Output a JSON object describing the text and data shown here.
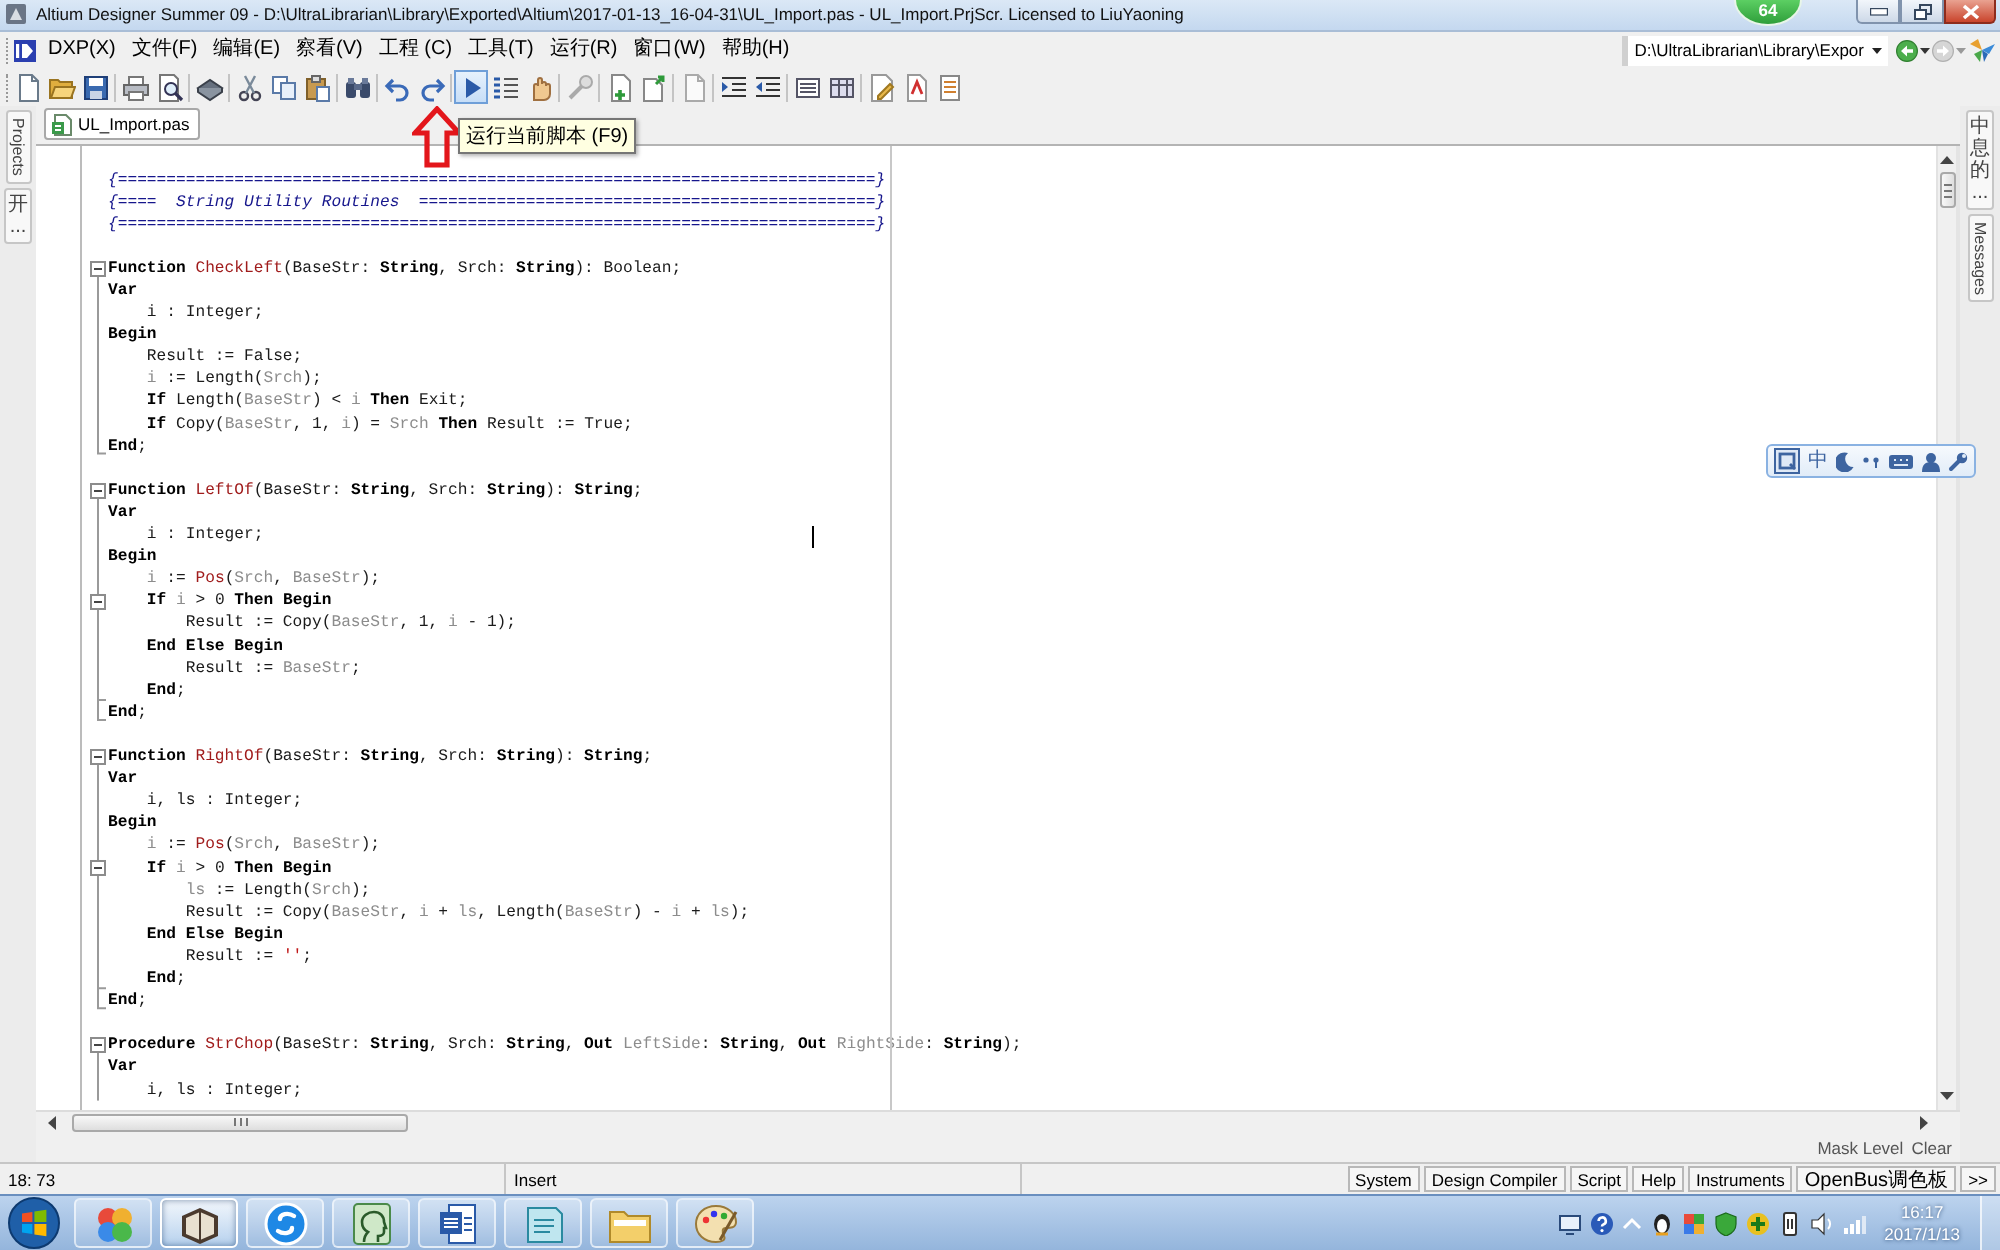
{
  "title_bar": {
    "title": "Altium Designer Summer 09 - D:\\UltraLibrarian\\Library\\Exported\\Altium\\2017-01-13_16-04-31\\UL_Import.pas - UL_Import.PrjScr. Licensed to LiuYaoning"
  },
  "floating_badge": {
    "text": "64"
  },
  "menu_bar": {
    "items": [
      "DXP(X)",
      "文件(F)",
      "编辑(E)",
      "察看(V)",
      "工程 (C)",
      "工具(T)",
      "运行(R)",
      "窗口(W)",
      "帮助(H)"
    ],
    "path": "D:\\UltraLibrarian\\Library\\Expor"
  },
  "toolbar": {
    "buttons": [
      {
        "kind": "new",
        "highlighted": false
      },
      {
        "kind": "open",
        "highlighted": false
      },
      {
        "kind": "save",
        "highlighted": false
      },
      {
        "kind": "separator"
      },
      {
        "kind": "print",
        "highlighted": false
      },
      {
        "kind": "preview",
        "highlighted": false
      },
      {
        "kind": "separator"
      },
      {
        "kind": "chip",
        "highlighted": false
      },
      {
        "kind": "separator"
      },
      {
        "kind": "cut",
        "highlighted": false
      },
      {
        "kind": "copy",
        "highlighted": false
      },
      {
        "kind": "paste",
        "highlighted": false
      },
      {
        "kind": "separator"
      },
      {
        "kind": "find",
        "highlighted": false
      },
      {
        "kind": "separator"
      },
      {
        "kind": "undo",
        "highlighted": false
      },
      {
        "kind": "redo",
        "highlighted": false
      },
      {
        "kind": "separator"
      },
      {
        "kind": "run",
        "highlighted": true
      },
      {
        "kind": "step",
        "highlighted": false
      },
      {
        "kind": "stop",
        "highlighted": false
      },
      {
        "kind": "separator"
      },
      {
        "kind": "wand",
        "highlighted": false
      },
      {
        "kind": "separator"
      },
      {
        "kind": "page_plus",
        "highlighted": false
      },
      {
        "kind": "page_arrow",
        "highlighted": false
      },
      {
        "kind": "separator"
      },
      {
        "kind": "page",
        "highlighted": false
      },
      {
        "kind": "separator"
      },
      {
        "kind": "indent",
        "highlighted": false
      },
      {
        "kind": "outdent",
        "highlighted": false
      },
      {
        "kind": "separator"
      },
      {
        "kind": "text_panel",
        "highlighted": false
      },
      {
        "kind": "table",
        "highlighted": false
      },
      {
        "kind": "separator"
      },
      {
        "kind": "pencil",
        "highlighted": false
      },
      {
        "kind": "pdf",
        "highlighted": false
      },
      {
        "kind": "list",
        "highlighted": false
      }
    ],
    "tooltip": "运行当前脚本 (F9)"
  },
  "left_panel_tabs": [
    "Projects",
    "开..."
  ],
  "right_panel_tabs": [
    "中息的...",
    "Messages"
  ],
  "document_tabs": [
    {
      "label": "UL_Import.pas",
      "selected": true
    }
  ],
  "editor": {
    "blocks": [
      {
        "lines": [
          {
            "tokens": [
              {
                "kind": "comment",
                "text": "{==============================================================================}"
              }
            ]
          },
          {
            "tokens": [
              {
                "kind": "comment",
                "text": "{====  String Utility Routines  ===============================================}"
              }
            ]
          },
          {
            "tokens": [
              {
                "kind": "comment",
                "text": "{==============================================================================}"
              }
            ]
          }
        ]
      },
      {
        "lines": [
          {
            "expanded": true,
            "tokens": [
              {
                "kind": "keyword",
                "text": "Function"
              },
              {
                "kind": "routine",
                "text": " CheckLeft"
              },
              {
                "kind": "plain",
                "text": "(BaseStr: "
              },
              {
                "kind": "keyword",
                "text": "String"
              },
              {
                "kind": "plain",
                "text": ", Srch: "
              },
              {
                "kind": "keyword",
                "text": "String"
              },
              {
                "kind": "plain",
                "text": "): Boolean;"
              }
            ]
          },
          {
            "tokens": [
              {
                "kind": "keyword",
                "text": "Var"
              }
            ]
          },
          {
            "tokens": [
              {
                "kind": "plain",
                "text": "    i : Integer;"
              }
            ]
          },
          {
            "tokens": [
              {
                "kind": "keyword",
                "text": "Begin"
              }
            ]
          },
          {
            "tokens": [
              {
                "kind": "plain",
                "text": "    Result := False;"
              }
            ]
          },
          {
            "tokens": [
              {
                "kind": "variable",
                "text": "    i"
              },
              {
                "kind": "plain",
                "text": " := Length("
              },
              {
                "kind": "variable",
                "text": "Srch"
              },
              {
                "kind": "plain",
                "text": ");"
              }
            ]
          },
          {
            "tokens": [
              {
                "kind": "keyword",
                "text": "    If"
              },
              {
                "kind": "plain",
                "text": " Length("
              },
              {
                "kind": "variable",
                "text": "BaseStr"
              },
              {
                "kind": "plain",
                "text": ") < "
              },
              {
                "kind": "variable",
                "text": "i"
              },
              {
                "kind": "keyword",
                "text": " Then"
              },
              {
                "kind": "plain",
                "text": " Exit;"
              }
            ]
          },
          {
            "tokens": [
              {
                "kind": "keyword",
                "text": "    If"
              },
              {
                "kind": "plain",
                "text": " Copy("
              },
              {
                "kind": "variable",
                "text": "BaseStr"
              },
              {
                "kind": "plain",
                "text": ", 1, "
              },
              {
                "kind": "variable",
                "text": "i"
              },
              {
                "kind": "plain",
                "text": ") = "
              },
              {
                "kind": "variable",
                "text": "Srch"
              },
              {
                "kind": "keyword",
                "text": " Then"
              },
              {
                "kind": "plain",
                "text": " Result := True;"
              }
            ]
          },
          {
            "fold_end": true,
            "tokens": [
              {
                "kind": "keyword",
                "text": "End"
              },
              {
                "kind": "plain",
                "text": ";"
              }
            ]
          }
        ]
      },
      {
        "lines": [
          {
            "expanded": true,
            "tokens": [
              {
                "kind": "keyword",
                "text": "Function"
              },
              {
                "kind": "routine",
                "text": " LeftOf"
              },
              {
                "kind": "plain",
                "text": "(BaseStr: "
              },
              {
                "kind": "keyword",
                "text": "String"
              },
              {
                "kind": "plain",
                "text": ", Srch: "
              },
              {
                "kind": "keyword",
                "text": "String"
              },
              {
                "kind": "plain",
                "text": "): "
              },
              {
                "kind": "keyword",
                "text": "String"
              },
              {
                "kind": "plain",
                "text": ";"
              }
            ]
          },
          {
            "tokens": [
              {
                "kind": "keyword",
                "text": "Var"
              }
            ]
          },
          {
            "tokens": [
              {
                "kind": "plain",
                "text": "    i : Integer;"
              }
            ]
          },
          {
            "tokens": [
              {
                "kind": "keyword",
                "text": "Begin"
              }
            ]
          },
          {
            "tokens": [
              {
                "kind": "variable",
                "text": "    i"
              },
              {
                "kind": "plain",
                "text": " := "
              },
              {
                "kind": "routine",
                "text": "Pos"
              },
              {
                "kind": "plain",
                "text": "("
              },
              {
                "kind": "variable",
                "text": "Srch"
              },
              {
                "kind": "plain",
                "text": ", "
              },
              {
                "kind": "variable",
                "text": "BaseStr"
              },
              {
                "kind": "plain",
                "text": ");"
              }
            ]
          },
          {
            "expanded": true,
            "tokens": [
              {
                "kind": "keyword",
                "text": "    If"
              },
              {
                "kind": "variable",
                "text": " i"
              },
              {
                "kind": "plain",
                "text": " > 0 "
              },
              {
                "kind": "keyword",
                "text": "Then Begin"
              }
            ]
          },
          {
            "tokens": [
              {
                "kind": "plain",
                "text": "        Result := Copy("
              },
              {
                "kind": "variable",
                "text": "BaseStr"
              },
              {
                "kind": "plain",
                "text": ", 1, "
              },
              {
                "kind": "variable",
                "text": "i"
              },
              {
                "kind": "plain",
                "text": " - 1);"
              }
            ]
          },
          {
            "tokens": [
              {
                "kind": "keyword",
                "text": "    End Else Begin"
              }
            ]
          },
          {
            "tokens": [
              {
                "kind": "plain",
                "text": "        Result := "
              },
              {
                "kind": "variable",
                "text": "BaseStr"
              },
              {
                "kind": "plain",
                "text": ";"
              }
            ]
          },
          {
            "fold_end": true,
            "tokens": [
              {
                "kind": "keyword",
                "text": "    End"
              },
              {
                "kind": "plain",
                "text": ";"
              }
            ]
          },
          {
            "fold_end": true,
            "tokens": [
              {
                "kind": "keyword",
                "text": "End"
              },
              {
                "kind": "plain",
                "text": ";"
              }
            ]
          }
        ]
      },
      {
        "lines": [
          {
            "expanded": true,
            "tokens": [
              {
                "kind": "keyword",
                "text": "Function"
              },
              {
                "kind": "routine",
                "text": " RightOf"
              },
              {
                "kind": "plain",
                "text": "(BaseStr: "
              },
              {
                "kind": "keyword",
                "text": "String"
              },
              {
                "kind": "plain",
                "text": ", Srch: "
              },
              {
                "kind": "keyword",
                "text": "String"
              },
              {
                "kind": "plain",
                "text": "): "
              },
              {
                "kind": "keyword",
                "text": "String"
              },
              {
                "kind": "plain",
                "text": ";"
              }
            ]
          },
          {
            "tokens": [
              {
                "kind": "keyword",
                "text": "Var"
              }
            ]
          },
          {
            "tokens": [
              {
                "kind": "plain",
                "text": "    i, ls : Integer;"
              }
            ]
          },
          {
            "tokens": [
              {
                "kind": "keyword",
                "text": "Begin"
              }
            ]
          },
          {
            "tokens": [
              {
                "kind": "variable",
                "text": "    i"
              },
              {
                "kind": "plain",
                "text": " := "
              },
              {
                "kind": "routine",
                "text": "Pos"
              },
              {
                "kind": "plain",
                "text": "("
              },
              {
                "kind": "variable",
                "text": "Srch"
              },
              {
                "kind": "plain",
                "text": ", "
              },
              {
                "kind": "variable",
                "text": "BaseStr"
              },
              {
                "kind": "plain",
                "text": ");"
              }
            ]
          },
          {
            "expanded": true,
            "tokens": [
              {
                "kind": "keyword",
                "text": "    If"
              },
              {
                "kind": "variable",
                "text": " i"
              },
              {
                "kind": "plain",
                "text": " > 0 "
              },
              {
                "kind": "keyword",
                "text": "Then Begin"
              }
            ]
          },
          {
            "tokens": [
              {
                "kind": "variable",
                "text": "        ls"
              },
              {
                "kind": "plain",
                "text": " := Length("
              },
              {
                "kind": "variable",
                "text": "Srch"
              },
              {
                "kind": "plain",
                "text": ");"
              }
            ]
          },
          {
            "tokens": [
              {
                "kind": "plain",
                "text": "        Result := Copy("
              },
              {
                "kind": "variable",
                "text": "BaseStr"
              },
              {
                "kind": "plain",
                "text": ", "
              },
              {
                "kind": "variable",
                "text": "i"
              },
              {
                "kind": "plain",
                "text": " + "
              },
              {
                "kind": "variable",
                "text": "ls"
              },
              {
                "kind": "plain",
                "text": ", Length("
              },
              {
                "kind": "variable",
                "text": "BaseStr"
              },
              {
                "kind": "plain",
                "text": ") - "
              },
              {
                "kind": "variable",
                "text": "i"
              },
              {
                "kind": "plain",
                "text": " + "
              },
              {
                "kind": "variable",
                "text": "ls"
              },
              {
                "kind": "plain",
                "text": ");"
              }
            ]
          },
          {
            "tokens": [
              {
                "kind": "keyword",
                "text": "    End Else Begin"
              }
            ]
          },
          {
            "tokens": [
              {
                "kind": "plain",
                "text": "        Result := "
              },
              {
                "kind": "string",
                "text": "''"
              },
              {
                "kind": "plain",
                "text": ";"
              }
            ]
          },
          {
            "fold_end": true,
            "tokens": [
              {
                "kind": "keyword",
                "text": "    End"
              },
              {
                "kind": "plain",
                "text": ";"
              }
            ]
          },
          {
            "fold_end": true,
            "tokens": [
              {
                "kind": "keyword",
                "text": "End"
              },
              {
                "kind": "plain",
                "text": ";"
              }
            ]
          }
        ]
      },
      {
        "lines": [
          {
            "expanded": true,
            "tokens": [
              {
                "kind": "keyword",
                "text": "Procedure"
              },
              {
                "kind": "routine",
                "text": " StrChop"
              },
              {
                "kind": "plain",
                "text": "(BaseStr: "
              },
              {
                "kind": "keyword",
                "text": "String"
              },
              {
                "kind": "plain",
                "text": ", Srch: "
              },
              {
                "kind": "keyword",
                "text": "String"
              },
              {
                "kind": "plain",
                "text": ", "
              },
              {
                "kind": "keyword",
                "text": "Out"
              },
              {
                "kind": "variable",
                "text": " LeftSide"
              },
              {
                "kind": "plain",
                "text": ": "
              },
              {
                "kind": "keyword",
                "text": "String"
              },
              {
                "kind": "plain",
                "text": ", "
              },
              {
                "kind": "keyword",
                "text": "Out"
              },
              {
                "kind": "variable",
                "text": " RightSide"
              },
              {
                "kind": "plain",
                "text": ": "
              },
              {
                "kind": "keyword",
                "text": "String"
              },
              {
                "kind": "plain",
                "text": ");"
              }
            ]
          },
          {
            "tokens": [
              {
                "kind": "keyword",
                "text": "Var"
              }
            ]
          },
          {
            "tokens": [
              {
                "kind": "plain",
                "text": "    i, ls : Integer;"
              }
            ]
          }
        ]
      }
    ]
  },
  "ime_toolbar": {
    "mode": "中"
  },
  "mask_controls": {
    "mask_level": "Mask Level",
    "clear": "Clear"
  },
  "status_bar": {
    "position": "18: 73",
    "mode": "Insert",
    "panels": [
      "System",
      "Design Compiler",
      "Script",
      "Help",
      "Instruments",
      "OpenBus调色板",
      ">>"
    ]
  },
  "taskbar": {
    "apps": [
      {
        "kind": "petals",
        "active": false
      },
      {
        "kind": "altium",
        "active": true
      },
      {
        "kind": "swirl",
        "active": false
      },
      {
        "kind": "head",
        "active": false
      },
      {
        "kind": "word",
        "active": false
      },
      {
        "kind": "notepad",
        "active": false
      },
      {
        "kind": "folder",
        "active": false
      },
      {
        "kind": "paint",
        "active": false
      }
    ],
    "time": "16:17",
    "date": "2017/1/13"
  }
}
